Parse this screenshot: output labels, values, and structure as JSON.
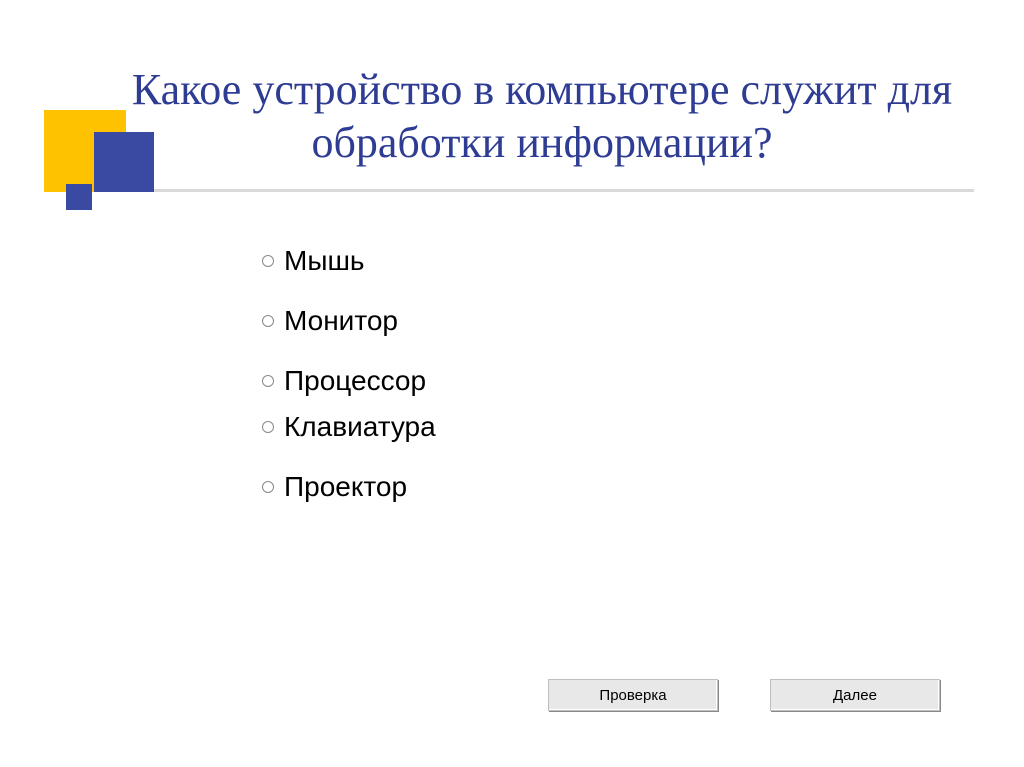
{
  "title": "Какое устройство в компьютере служит для обработки информации?",
  "options": [
    {
      "label": "Мышь"
    },
    {
      "label": "Монитор"
    },
    {
      "label": "Процессор"
    },
    {
      "label": "Клавиатура"
    },
    {
      "label": "Проектор"
    }
  ],
  "buttons": {
    "check": "Проверка",
    "next": "Далее"
  }
}
